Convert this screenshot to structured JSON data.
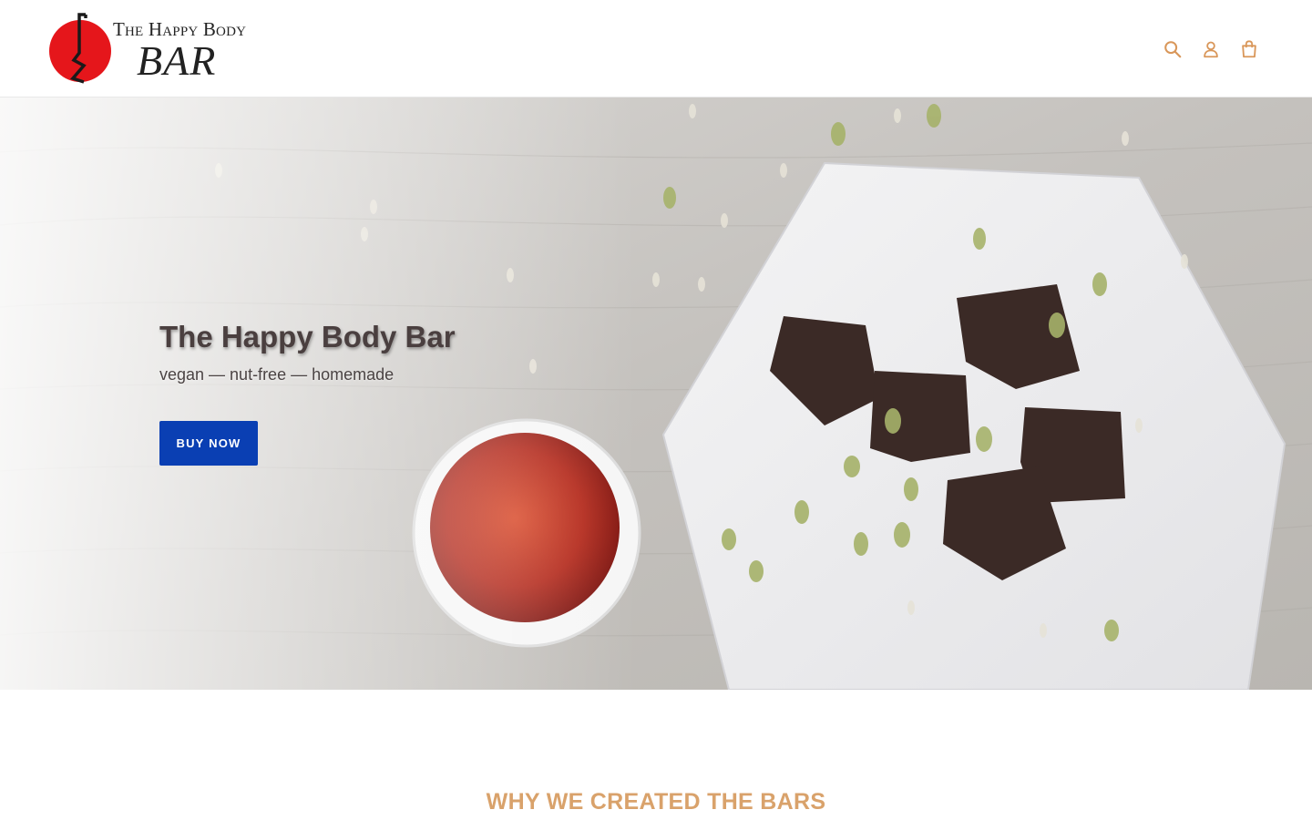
{
  "header": {
    "logo": {
      "line1": "The Happy Body",
      "line2": "BAR"
    },
    "icons": [
      "search-icon",
      "account-icon",
      "cart-icon"
    ],
    "accent_color": "#d9975a"
  },
  "hero": {
    "title": "The Happy Body Bar",
    "subtitle": "vegan — nut-free — homemade",
    "button_label": "BUY NOW",
    "button_color": "#0a3fb3"
  },
  "section": {
    "title": "WHY WE CREATED THE BARS",
    "title_color": "#d9a26b"
  }
}
